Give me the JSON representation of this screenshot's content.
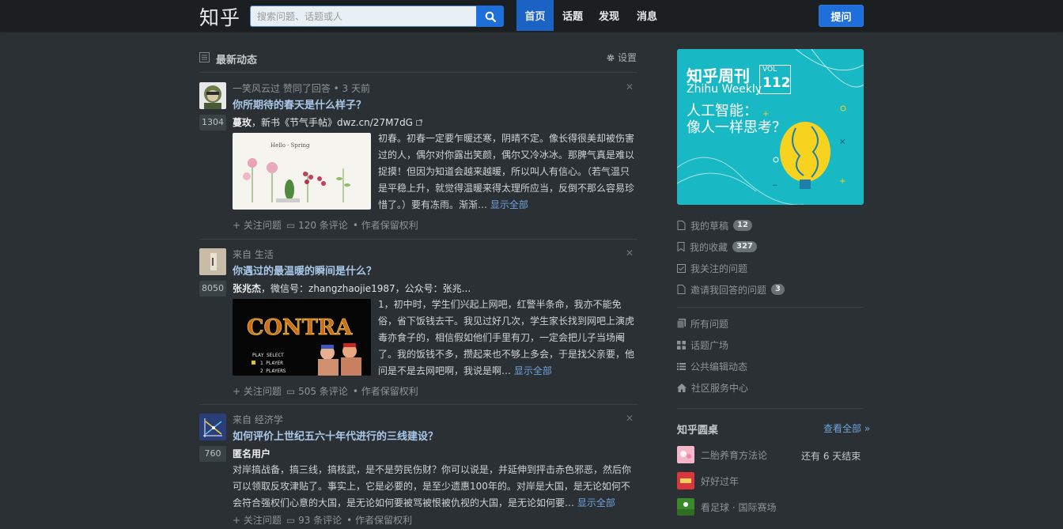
{
  "header": {
    "logo": "知乎",
    "search_placeholder": "搜索问题、话题或人",
    "nav": [
      "首页",
      "话题",
      "发现",
      "消息"
    ],
    "ask_label": "提问"
  },
  "feed": {
    "title": "最新动态",
    "settings_label": "设置",
    "items": [
      {
        "meta": "一笑风云过 赞同了回答 • 3 天前",
        "question": "你所期待的春天是什么样子？",
        "votes": "1304",
        "author": "蔓玫",
        "author_bio": "，新书《节气手帖》dwz.cn/27M7dG",
        "excerpt": "初春。初春一定要乍暖还寒，阴晴不定。像长得很美却被伤害过的人，偶尔对你露出笑颜，偶尔又冷冰冰。那脾气真是难以捉摸！但因为知道会越来越暖，所以叫人有信心。（若气温只是平稳上升，就觉得温暖来得太理所应当，反倒不那么容易珍惜了。）要有冻雨。渐渐…",
        "more": "显示全部",
        "follow": "关注问题",
        "comments": "120 条评论",
        "rights": "• 作者保留权利",
        "thumb_text": "Hello · Spring"
      },
      {
        "meta": "来自 生活",
        "question": "你遇过的最温暖的瞬间是什么？",
        "votes": "8050",
        "author": "张兆杰",
        "author_bio": "，微信号：zhangzhaojie1987，公众号：张兆...",
        "excerpt": "1，初中时，学生们兴起上网吧，红警半条命，我亦不能免俗，省下饭钱去干。我见过好几次，学生家长找到网吧上演虎毒亦食子的，相信假如他们手里有刀，一定会把儿子当场阉了。我的饭钱不多，攒起来也不够上多会，于是找父亲要，他问是不是去网吧啊，我说是啊…",
        "more": "显示全部",
        "follow": "关注问题",
        "comments": "505 条评论",
        "rights": "• 作者保留权利",
        "thumb_title": "CONTRA",
        "thumb_lines": [
          "PLAY SELECT",
          "1 PLAYER",
          "2 PLAYERS"
        ]
      },
      {
        "meta": "来自 经济学",
        "question": "如何评价上世纪五六十年代进行的三线建设？",
        "votes": "760",
        "author": "匿名用户",
        "excerpt": "对岸搞战备，搞三线，搞核武，是不是劳民伤财？你可以说是，并延伸到抨击赤色邪恶，然后你可以领取反攻津贴了。事实上，它是必要的，是至少遗惠100年的。对岸是大国，是无论如何不会符合强权们心意的大国，是无论如何要被骂被恨被仇视的大国，是无论如何要…",
        "more": "显示全部",
        "follow": "关注问题",
        "comments": "93 条评论",
        "rights": "• 作者保留权利"
      }
    ]
  },
  "sidebar": {
    "banner": {
      "title": "知乎周刊",
      "vol_label": "VOL",
      "vol_num": "112",
      "subtitle": "Zhihu Weekly",
      "line1": "人工智能：",
      "line2": "像人一样思考？"
    },
    "links1": [
      {
        "label": "我的草稿",
        "badge": "12"
      },
      {
        "label": "我的收藏",
        "badge": "327"
      },
      {
        "label": "我关注的问题",
        "badge": ""
      },
      {
        "label": "邀请我回答的问题",
        "badge": "3"
      }
    ],
    "links2": [
      "所有问题",
      "话题广场",
      "公共编辑动态",
      "社区服务中心"
    ],
    "roundtable": {
      "title": "知乎圆桌",
      "see_all": "查看全部 »",
      "items": [
        {
          "label": "二胎养育方法论",
          "status": "还有 6 天结束"
        },
        {
          "label": "好好过年",
          "status": ""
        },
        {
          "label": "看足球 · 国际赛场",
          "status": ""
        }
      ]
    }
  }
}
